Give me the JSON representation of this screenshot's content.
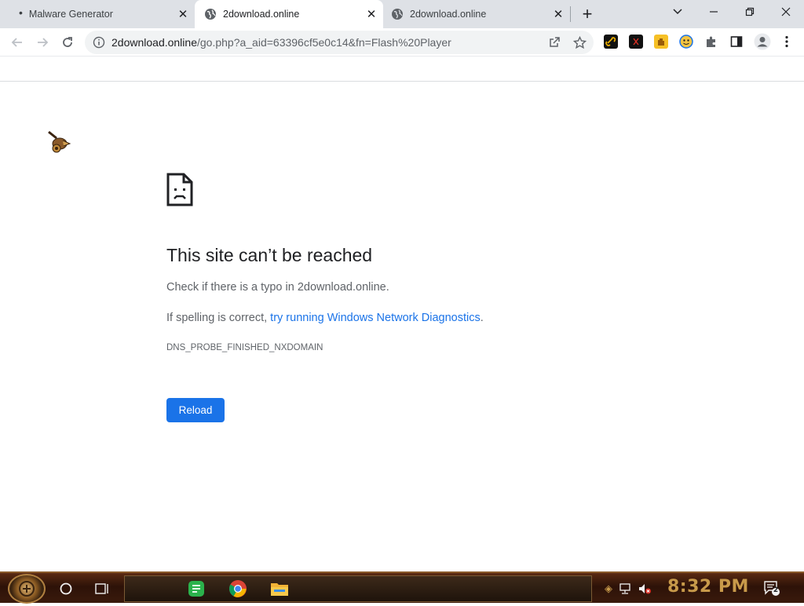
{
  "tabs": [
    {
      "title": "Malware Generator",
      "active": false
    },
    {
      "title": "2download.online",
      "active": true
    },
    {
      "title": "2download.online",
      "active": false
    }
  ],
  "address_bar": {
    "host": "2download.online",
    "path": "/go.php?a_aid=63396cf5e0c14&fn=Flash%20Player"
  },
  "error_page": {
    "title": "This site can’t be reached",
    "check_typo": "Check if there is a typo in 2download.online.",
    "spelling_prefix": "If spelling is correct, ",
    "diagnostics_link": "try running Windows Network Diagnostics",
    "spelling_suffix": ".",
    "error_code": "DNS_PROBE_FINISHED_NXDOMAIN",
    "reload_label": "Reload"
  },
  "taskbar": {
    "clock": "8:32 PM",
    "notification_count": "2"
  },
  "colors": {
    "accent": "#1a73e8",
    "clock": "#c89a4a"
  }
}
